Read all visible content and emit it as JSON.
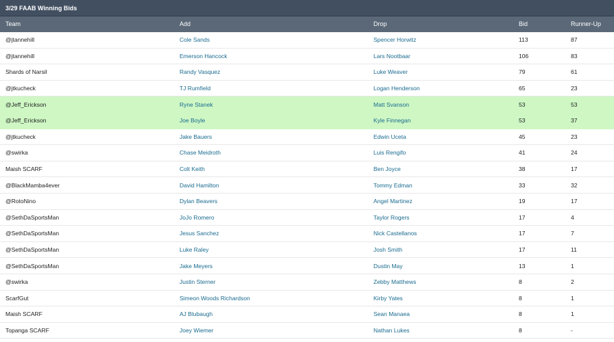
{
  "title": "3/29 FAAB Winning Bids",
  "columns": {
    "team": "Team",
    "add": "Add",
    "drop": "Drop",
    "bid": "Bid",
    "runner_up": "Runner-Up"
  },
  "rows": [
    {
      "team": "@jtannehill",
      "add": "Cole Sands",
      "drop": "Spencer Horwitz",
      "bid": "113",
      "runner_up": "87",
      "highlight": false
    },
    {
      "team": "@jtannehill",
      "add": "Emerson Hancock",
      "drop": "Lars Nootbaar",
      "bid": "106",
      "runner_up": "83",
      "highlight": false
    },
    {
      "team": "Shards of Narsil",
      "add": "Randy Vasquez",
      "drop": "Luke Weaver",
      "bid": "79",
      "runner_up": "61",
      "highlight": false
    },
    {
      "team": "@jtkucheck",
      "add": "TJ Rumfield",
      "drop": "Logan Henderson",
      "bid": "65",
      "runner_up": "23",
      "highlight": false
    },
    {
      "team": "@Jeff_Erickson",
      "add": "Ryne Stanek",
      "drop": "Matt Svanson",
      "bid": "53",
      "runner_up": "53",
      "highlight": true
    },
    {
      "team": "@Jeff_Erickson",
      "add": "Joe Boyle",
      "drop": "Kyle Finnegan",
      "bid": "53",
      "runner_up": "37",
      "highlight": true
    },
    {
      "team": "@jtkucheck",
      "add": "Jake Bauers",
      "drop": "Edwin Uceta",
      "bid": "45",
      "runner_up": "23",
      "highlight": false
    },
    {
      "team": "@swirka",
      "add": "Chase Meidroth",
      "drop": "Luis Rengifo",
      "bid": "41",
      "runner_up": "24",
      "highlight": false
    },
    {
      "team": "Maish SCARF",
      "add": "Colt Keith",
      "drop": "Ben Joyce",
      "bid": "38",
      "runner_up": "17",
      "highlight": false
    },
    {
      "team": "@BlackMamba4ever",
      "add": "David Hamilton",
      "drop": "Tommy Edman",
      "bid": "33",
      "runner_up": "32",
      "highlight": false
    },
    {
      "team": "@RotoNino",
      "add": "Dylan Beavers",
      "drop": "Angel Martinez",
      "bid": "19",
      "runner_up": "17",
      "highlight": false
    },
    {
      "team": "@SethDaSportsMan",
      "add": "JoJo Romero",
      "drop": "Taylor Rogers",
      "bid": "17",
      "runner_up": "4",
      "highlight": false
    },
    {
      "team": "@SethDaSportsMan",
      "add": "Jesus Sanchez",
      "drop": "Nick Castellanos",
      "bid": "17",
      "runner_up": "7",
      "highlight": false
    },
    {
      "team": "@SethDaSportsMan",
      "add": "Luke Raley",
      "drop": "Josh Smith",
      "bid": "17",
      "runner_up": "11",
      "highlight": false
    },
    {
      "team": "@SethDaSportsMan",
      "add": "Jake Meyers",
      "drop": "Dustin May",
      "bid": "13",
      "runner_up": "1",
      "highlight": false
    },
    {
      "team": "@swirka",
      "add": "Justin Sterner",
      "drop": "Zebby Matthews",
      "bid": "8",
      "runner_up": "2",
      "highlight": false
    },
    {
      "team": "ScarfGut",
      "add": "Simeon Woods Richardson",
      "drop": "Kirby Yates",
      "bid": "8",
      "runner_up": "1",
      "highlight": false
    },
    {
      "team": "Maish SCARF",
      "add": "AJ Blubaugh",
      "drop": "Sean Manaea",
      "bid": "8",
      "runner_up": "1",
      "highlight": false
    },
    {
      "team": "Topanga SCARF",
      "add": "Joey Wiemer",
      "drop": "Nathan Lukes",
      "bid": "8",
      "runner_up": "-",
      "highlight": false
    }
  ]
}
